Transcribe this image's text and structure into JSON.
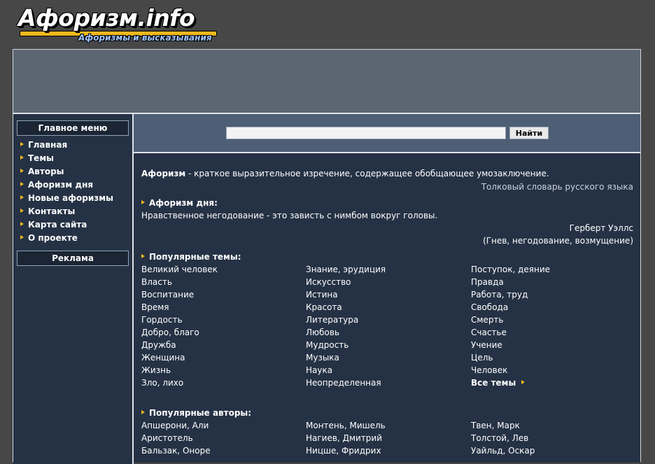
{
  "logo": {
    "title": "Афоризм.info",
    "subtitle": "Афоризмы и высказывания"
  },
  "sidebar": {
    "menu_title": "Главное меню",
    "items": [
      {
        "label": "Главная"
      },
      {
        "label": "Темы"
      },
      {
        "label": "Авторы"
      },
      {
        "label": "Афоризм дня"
      },
      {
        "label": "Новые афоризмы"
      },
      {
        "label": "Контакты"
      },
      {
        "label": "Карта сайта"
      },
      {
        "label": "О проекте"
      }
    ],
    "ads_title": "Реклама"
  },
  "search": {
    "value": "",
    "button": "Найти"
  },
  "definition": {
    "term": "Афоризм",
    "text": " - краткое выразительное изречение, содержащее обобщающее умозаключение.",
    "source": "Толковый словарь русского языка"
  },
  "day": {
    "heading": "Афоризм дня:",
    "quote": "Нравственное негодование - это зависть с нимбом вокруг головы.",
    "author": "Герберт Уэллс",
    "tags": "(Гнев, негодование, возмущение)"
  },
  "topics": {
    "heading": "Популярные темы:",
    "col1": [
      "Великий человек",
      "Власть",
      "Воспитание",
      "Время",
      "Гордость",
      "Добро, благо",
      "Дружба",
      "Женщина",
      "Жизнь",
      "Зло, лихо"
    ],
    "col2": [
      "Знание, эрудиция",
      "Искусство",
      "Истина",
      "Красота",
      "Литература",
      "Любовь",
      "Мудрость",
      "Музыка",
      "Наука",
      "Неопределенная"
    ],
    "col3": [
      "Поступок, деяние",
      "Правда",
      "Работа, труд",
      "Свобода",
      "Смерть",
      "Счастье",
      "Учение",
      "Цель",
      "Человек"
    ],
    "all": "Все темы"
  },
  "authors": {
    "heading": "Популярные авторы:",
    "col1": [
      "Апшерони, Али",
      "Аристотель",
      "Бальзак, Оноре"
    ],
    "col2": [
      "Монтень, Мишель",
      "Нагиев, Дмитрий",
      "Ницше, Фридрих"
    ],
    "col3": [
      "Твен, Марк",
      "Толстой, Лев",
      "Уайльд, Оскар"
    ]
  }
}
